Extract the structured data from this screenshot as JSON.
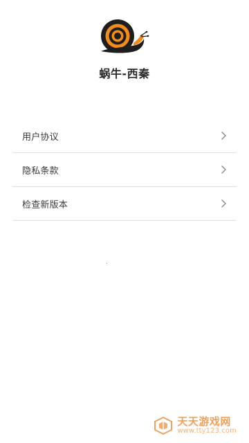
{
  "app": {
    "name": "蜗牛-西秦"
  },
  "menu": {
    "items": [
      {
        "label": "用户协议"
      },
      {
        "label": "隐私条款"
      },
      {
        "label": "检查新版本"
      }
    ]
  },
  "icons": {
    "logo": "snail-logo-icon",
    "chevron": "chevron-right-icon",
    "watermark": "tiantian-logo-icon"
  },
  "colors": {
    "logo_orange": "#f28c1b",
    "logo_dark": "#1e1e1e",
    "chevron": "#8d8d8d",
    "divider": "#dedede",
    "watermark_orange": "#f0a25c"
  },
  "watermark": {
    "title": "天天游戏网",
    "url": "www.tty123.com"
  }
}
